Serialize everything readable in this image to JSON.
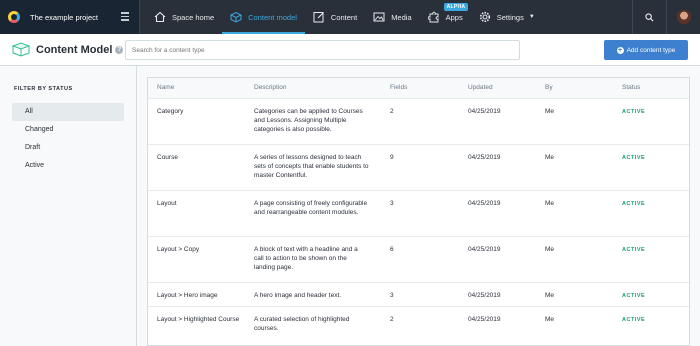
{
  "topnav": {
    "project_name": "The example project",
    "items": [
      {
        "label": "Space home",
        "icon": "home-icon"
      },
      {
        "label": "Content model",
        "icon": "content-model-icon"
      },
      {
        "label": "Content",
        "icon": "content-edit-icon"
      },
      {
        "label": "Media",
        "icon": "media-icon"
      },
      {
        "label": "Apps",
        "icon": "puzzle-icon",
        "badge": "ALPHA"
      },
      {
        "label": "Settings",
        "icon": "gear-icon"
      }
    ],
    "active_item": "Content model"
  },
  "subheader": {
    "title": "Content Model",
    "help": "?",
    "search_placeholder": "Search for a content type",
    "add_button": "Add content type"
  },
  "sidebar": {
    "heading": "FILTER BY STATUS",
    "items": [
      "All",
      "Changed",
      "Draft",
      "Active"
    ],
    "selected": "All"
  },
  "table": {
    "columns": [
      "Name",
      "Description",
      "Fields",
      "Updated",
      "By",
      "Status"
    ],
    "rows": [
      {
        "name": "Category",
        "description": "Categories can be applied to Courses and Lessons. Assigning Multiple categories is also possible.",
        "fields": "2",
        "updated": "04/25/2019",
        "by": "Me",
        "status": "ACTIVE"
      },
      {
        "name": "Course",
        "description": "A series of lessons designed to teach sets of concepts that enable students to master Contentful.",
        "fields": "9",
        "updated": "04/25/2019",
        "by": "Me",
        "status": "ACTIVE"
      },
      {
        "name": "Layout",
        "description": "A page consisting of freely configurable and rearrangeable content modules.",
        "fields": "3",
        "updated": "04/25/2019",
        "by": "Me",
        "status": "ACTIVE"
      },
      {
        "name": "Layout > Copy",
        "description": "A block of text with a headline and a call to action to be shown on the landing page.",
        "fields": "6",
        "updated": "04/25/2019",
        "by": "Me",
        "status": "ACTIVE"
      },
      {
        "name": "Layout > Hero image",
        "description": "A hero image and header text.",
        "fields": "3",
        "updated": "04/25/2019",
        "by": "Me",
        "status": "ACTIVE"
      },
      {
        "name": "Layout > Highlighted Course",
        "description": "A curated selection of highlighted courses.",
        "fields": "2",
        "updated": "04/25/2019",
        "by": "Me",
        "status": "ACTIVE"
      }
    ]
  },
  "colors": {
    "nav_bg": "#2a3039",
    "accent": "#3aa9e0",
    "primary_button": "#3c80cf",
    "status_active": "#12a26f"
  }
}
